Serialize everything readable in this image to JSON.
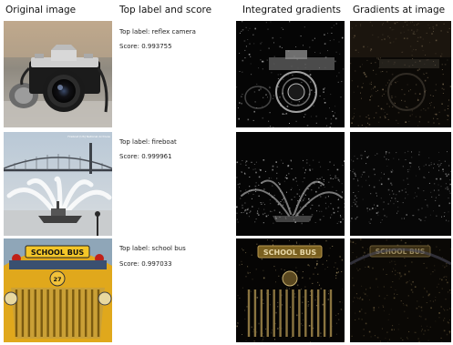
{
  "headers": {
    "original": "Original image",
    "label_score": "Top label and score",
    "integrated": "Integrated gradients",
    "gradients": "Gradients at image"
  },
  "rows": [
    {
      "label": "Top label: reflex camera",
      "score": "Score: 0.993755",
      "subject": "reflex-camera"
    },
    {
      "label": "Top label: fireboat",
      "score": "Score: 0.999961",
      "subject": "fireboat",
      "watermark": "Fireboat [US] National Archives"
    },
    {
      "label": "Top label: school bus",
      "score": "Score: 0.997033",
      "subject": "school-bus",
      "sign_text": "SCHOOL BUS",
      "bus_number": "27"
    }
  ]
}
